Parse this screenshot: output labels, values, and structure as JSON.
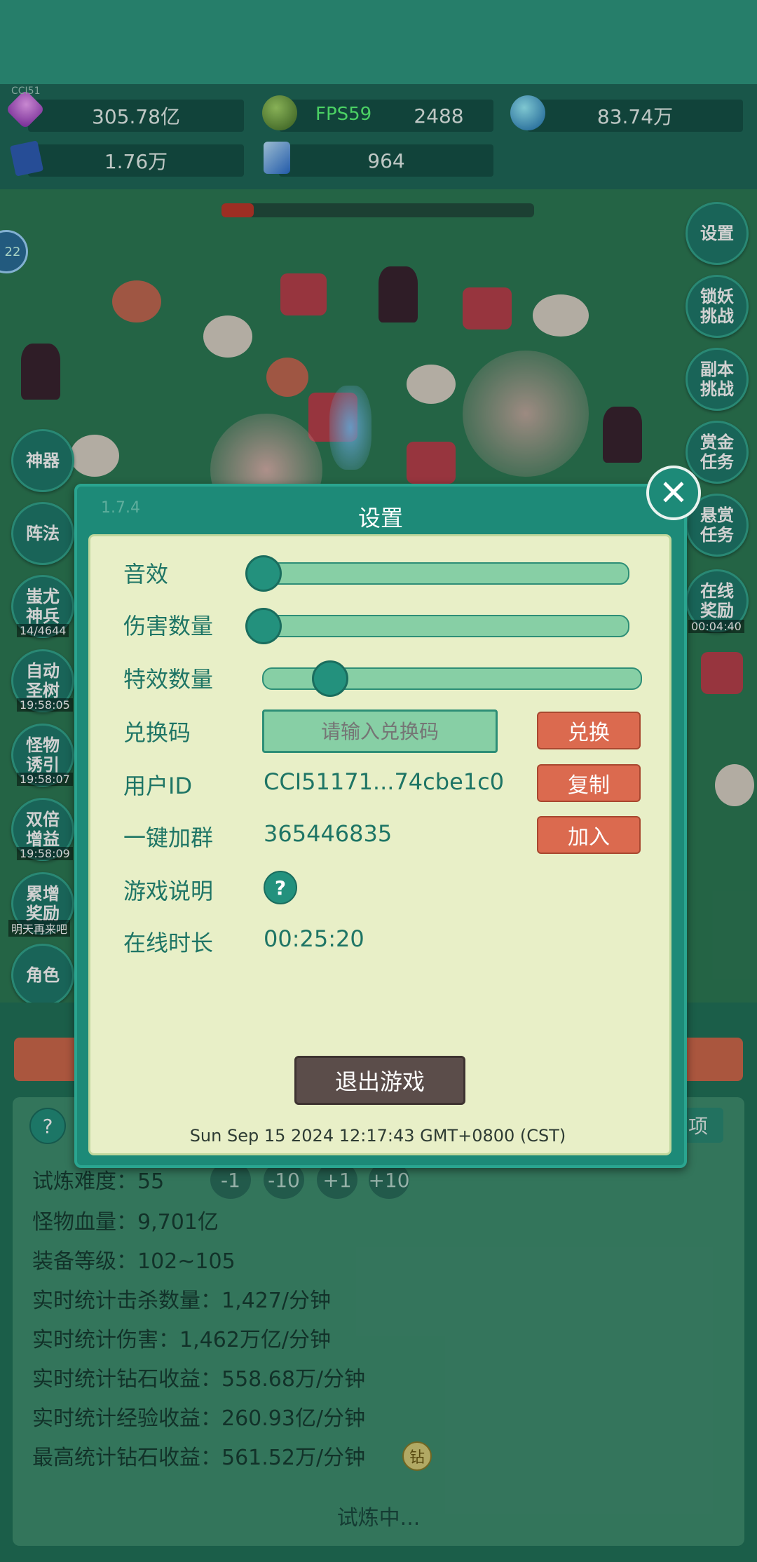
{
  "resources": {
    "diamond": "305.78亿",
    "emerald": "2488",
    "orb": "83.74万",
    "book": "1.76万",
    "crystal": "964"
  },
  "overlay_text": {
    "watermark": "CCI51",
    "fps": "FPS59"
  },
  "left_buttons": [
    {
      "label": "神器"
    },
    {
      "label": "阵法"
    },
    {
      "label": "蚩尤\n神兵",
      "sub": "14/4644"
    },
    {
      "label": "自动\n圣树",
      "sub": "19:58:05"
    },
    {
      "label": "怪物\n诱引",
      "sub": "19:58:07"
    },
    {
      "label": "双倍\n增益",
      "sub": "19:58:09"
    },
    {
      "label": "累增\n奖励",
      "sub": "明天再来吧"
    },
    {
      "label": "角色"
    }
  ],
  "right_buttons": [
    {
      "label": "设置"
    },
    {
      "label": "锁妖\n挑战"
    },
    {
      "label": "副本\n挑战"
    },
    {
      "label": "赏金\n任务"
    },
    {
      "label": "悬赏\n任务"
    },
    {
      "label": "在线\n奖励",
      "sub": "00:04:40"
    }
  ],
  "level_badge": "22",
  "dialog": {
    "version": "1.7.4",
    "title": "设置",
    "sound_label": "音效",
    "sound_level": 0.0,
    "damage_label": "伤害数量",
    "damage_level": 0.0,
    "effects_label": "特效数量",
    "effects_level": 0.15,
    "code_label": "兑换码",
    "code_placeholder": "请输入兑换码",
    "redeem_label": "兑换",
    "userid_label": "用户ID",
    "userid_value": "CCI51171...74cbe1c0",
    "copy_label": "复制",
    "group_label": "一键加群",
    "group_value": "365446835",
    "join_label": "加入",
    "help_label": "游戏说明",
    "help_icon_text": "?",
    "online_label": "在线时长",
    "online_value": "00:25:20",
    "exit_label": "退出游戏",
    "datetime": "Sun Sep 15 2024 12:17:43 GMT+0800 (CST)",
    "close_icon_text": "✕"
  },
  "stats": {
    "help_icon_text": "?",
    "options_label": "项",
    "difficulty": "试炼难度：55",
    "adjust": [
      "-1",
      "-10",
      "+1",
      "+10"
    ],
    "monster_hp": "怪物血量：9,701亿",
    "equip_level": "装备等级：102~105",
    "kills": "实时统计击杀数量：1,427/分钟",
    "damage": "实时统计伤害：1,462万亿/分钟",
    "diamond_income": "实时统计钻石收益：558.68万/分钟",
    "exp_income": "实时统计经验收益：260.93亿/分钟",
    "max_diamond_income": "最高统计钻石收益：561.52万/分钟",
    "diamond_badge": "钻",
    "status": "试炼中..."
  },
  "colors": {
    "accent": "#1d8a78",
    "panel": "#e8efc7",
    "action": "#db6a4f",
    "exit": "#5b4d4a"
  }
}
